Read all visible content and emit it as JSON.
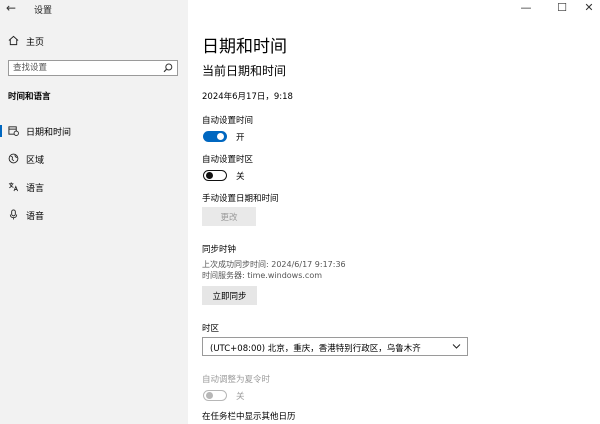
{
  "window": {
    "back_glyph": "←",
    "title": "设置",
    "minimize_glyph": "—",
    "maximize_glyph": "☐",
    "close_glyph": "✕"
  },
  "sidebar": {
    "home_label": "主页",
    "search_placeholder": "查找设置",
    "section_title": "时间和语言",
    "items": [
      {
        "label": "日期和时间",
        "icon": "calendar-clock-icon",
        "selected": true
      },
      {
        "label": "区域",
        "icon": "globe-icon",
        "selected": false
      },
      {
        "label": "语言",
        "icon": "language-icon",
        "selected": false
      },
      {
        "label": "语音",
        "icon": "microphone-icon",
        "selected": false
      }
    ]
  },
  "main": {
    "page_title": "日期和时间",
    "subtitle": "当前日期和时间",
    "current_datetime": "2024年6月17日，9:18",
    "auto_time": {
      "label": "自动设置时间",
      "state": "开",
      "on": true
    },
    "auto_timezone": {
      "label": "自动设置时区",
      "state": "关",
      "on": false
    },
    "manual": {
      "label": "手动设置日期和时间",
      "button": "更改"
    },
    "sync": {
      "label": "同步时钟",
      "last_sync": "上次成功同步时间: 2024/6/17 9:17:36",
      "server": "时间服务器: time.windows.com",
      "button": "立即同步"
    },
    "timezone": {
      "label": "时区",
      "selected": "(UTC+08:00) 北京，重庆，香港特别行政区，乌鲁木齐"
    },
    "dst": {
      "label": "自动调整为夏令时",
      "state": "关",
      "on": false
    },
    "extra_calendar_label": "在任务栏中显示其他日历"
  },
  "colors": {
    "accent": "#0067c0",
    "sidebar_bg": "#f2f2f2",
    "button_bg": "#e6e6e6",
    "disabled": "#9a9a9a"
  }
}
